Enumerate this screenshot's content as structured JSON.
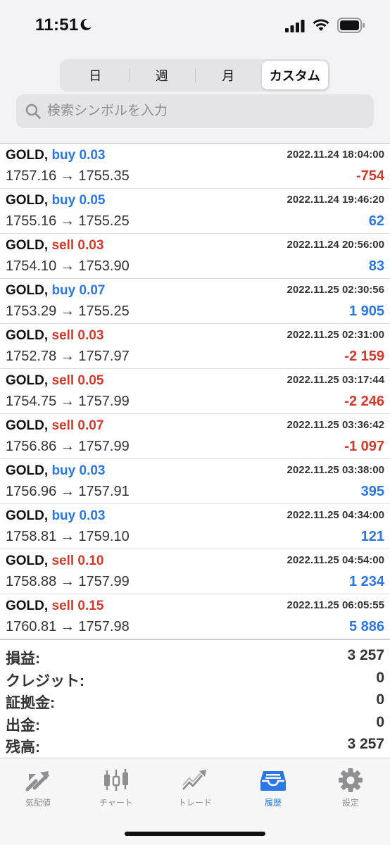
{
  "status": {
    "time": "11:51"
  },
  "segments": [
    {
      "label": "日",
      "active": false
    },
    {
      "label": "週",
      "active": false
    },
    {
      "label": "月",
      "active": false
    },
    {
      "label": "カスタム",
      "active": true
    }
  ],
  "search": {
    "placeholder": "検索シンボルを入力"
  },
  "trades": [
    {
      "symbol": "GOLD,",
      "type": "buy 0.03",
      "side": "buy",
      "time": "2022.11.24 18:04:00",
      "prices": "1757.16 → 1755.35",
      "profit": "-754"
    },
    {
      "symbol": "GOLD,",
      "type": "buy 0.05",
      "side": "buy",
      "time": "2022.11.24 19:46:20",
      "prices": "1755.16 → 1755.25",
      "profit": "62"
    },
    {
      "symbol": "GOLD,",
      "type": "sell 0.03",
      "side": "sell",
      "time": "2022.11.24 20:56:00",
      "prices": "1754.10 → 1753.90",
      "profit": "83"
    },
    {
      "symbol": "GOLD,",
      "type": "buy 0.07",
      "side": "buy",
      "time": "2022.11.25 02:30:56",
      "prices": "1753.29 → 1755.25",
      "profit": "1 905"
    },
    {
      "symbol": "GOLD,",
      "type": "sell 0.03",
      "side": "sell",
      "time": "2022.11.25 02:31:00",
      "prices": "1752.78 → 1757.97",
      "profit": "-2 159"
    },
    {
      "symbol": "GOLD,",
      "type": "sell 0.05",
      "side": "sell",
      "time": "2022.11.25 03:17:44",
      "prices": "1754.75 → 1757.99",
      "profit": "-2 246"
    },
    {
      "symbol": "GOLD,",
      "type": "sell 0.07",
      "side": "sell",
      "time": "2022.11.25 03:36:42",
      "prices": "1756.86 → 1757.99",
      "profit": "-1 097"
    },
    {
      "symbol": "GOLD,",
      "type": "buy 0.03",
      "side": "buy",
      "time": "2022.11.25 03:38:00",
      "prices": "1756.96 → 1757.91",
      "profit": "395"
    },
    {
      "symbol": "GOLD,",
      "type": "buy 0.03",
      "side": "buy",
      "time": "2022.11.25 04:34:00",
      "prices": "1758.81 → 1759.10",
      "profit": "121"
    },
    {
      "symbol": "GOLD,",
      "type": "sell 0.10",
      "side": "sell",
      "time": "2022.11.25 04:54:00",
      "prices": "1758.88 → 1757.99",
      "profit": "1 234"
    },
    {
      "symbol": "GOLD,",
      "type": "sell 0.15",
      "side": "sell",
      "time": "2022.11.25 06:05:55",
      "prices": "1760.81 → 1757.98",
      "profit": "5 886"
    }
  ],
  "summary": [
    {
      "label": "損益:",
      "value": "3 257"
    },
    {
      "label": "クレジット:",
      "value": "0"
    },
    {
      "label": "証拠金:",
      "value": "0"
    },
    {
      "label": "出金:",
      "value": "0"
    },
    {
      "label": "残高:",
      "value": "3 257"
    }
  ],
  "tabs": [
    {
      "label": "気配値",
      "icon": "quotes-icon",
      "active": false
    },
    {
      "label": "チャート",
      "icon": "chart-icon",
      "active": false
    },
    {
      "label": "トレード",
      "icon": "trade-icon",
      "active": false
    },
    {
      "label": "履歴",
      "icon": "history-icon",
      "active": true
    },
    {
      "label": "設定",
      "icon": "settings-icon",
      "active": false
    }
  ],
  "colors": {
    "buy": "#2b78e4",
    "sell": "#d23a2c",
    "accent": "#2b78e4",
    "inactive": "#8e8e93"
  }
}
